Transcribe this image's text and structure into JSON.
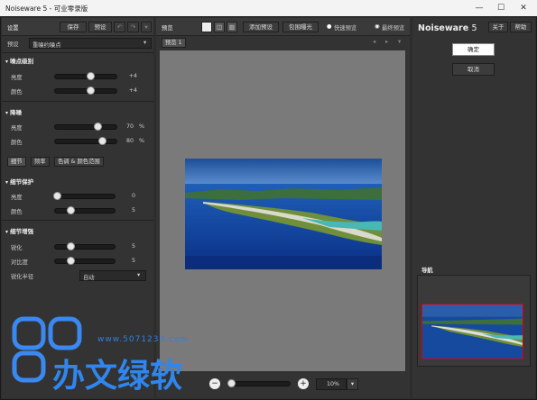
{
  "window": {
    "title": "Noiseware 5 - 可业零录版",
    "min": "—",
    "max": "☐",
    "close": "✕"
  },
  "left": {
    "settings_label": "设置",
    "save_btn": "保存",
    "preset_btn": "预设",
    "preset_label": "预设",
    "preset_value": "重噪约噪点",
    "sections": {
      "noise_level": "噪点级别",
      "noise_reduction": "降噪",
      "detail_protection": "细节保护",
      "detail_enhance": "细节增强"
    },
    "noise_level": [
      {
        "label": "亮度",
        "value": "+4",
        "pos": 0.57
      },
      {
        "label": "颜色",
        "value": "+4",
        "pos": 0.57
      }
    ],
    "noise_reduction": [
      {
        "label": "亮度",
        "value": "70",
        "unit": "%",
        "pos": 0.68
      },
      {
        "label": "颜色",
        "value": "80",
        "unit": "%",
        "pos": 0.75
      }
    ],
    "tabs": [
      "细节",
      "频率",
      "色调 & 颜色范围"
    ],
    "detail_protection": [
      {
        "label": "亮度",
        "value": "0",
        "pos": 0.04
      },
      {
        "label": "颜色",
        "value": "5",
        "pos": 0.26
      }
    ],
    "detail_enhance": [
      {
        "label": "锐化",
        "value": "5",
        "pos": 0.26
      },
      {
        "label": "对比度",
        "value": "5",
        "pos": 0.26
      }
    ],
    "sharpen_method_label": "锐化半径",
    "sharpen_method_value": "自动"
  },
  "center": {
    "preview_label": "预览",
    "add_preset": "添加预设",
    "bypass": "包围曝光",
    "fast_preview": "快速预览",
    "final_preview": "最终预览",
    "tab": "预览 1",
    "zoom": "10%",
    "zoom_level": 0.06
  },
  "right": {
    "logo_a": "Noiseware",
    "logo_b": "5",
    "about": "关于",
    "help": "帮助",
    "ok": "确定",
    "cancel": "取消",
    "navigator": "导航"
  },
  "watermark": {
    "url": "www.5071233.com",
    "text": "办文绿软"
  }
}
